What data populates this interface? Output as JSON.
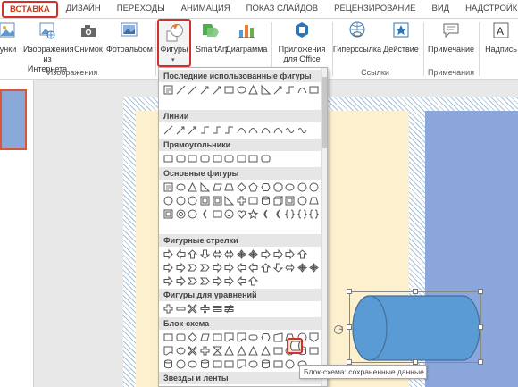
{
  "tabs": [
    {
      "label": "ВСТАВКА",
      "active": true
    },
    {
      "label": "ДИЗАЙН"
    },
    {
      "label": "ПЕРЕХОДЫ"
    },
    {
      "label": "АНИМАЦИЯ"
    },
    {
      "label": "ПОКАЗ СЛАЙДОВ"
    },
    {
      "label": "РЕЦЕНЗИРОВАНИЕ"
    },
    {
      "label": "ВИД"
    },
    {
      "label": "НАДСТРОЙКИ"
    }
  ],
  "ribbon": {
    "pictures": "унки",
    "online_images_l1": "Изображения",
    "online_images_l2": "из Интернета",
    "screenshot": "Снимок",
    "photo_album": "Фотоальбом",
    "shapes": "Фигуры",
    "smartart": "SmartArt",
    "chart": "Диаграмма",
    "apps_l1": "Приложения",
    "apps_l2": "для Office",
    "hyperlink": "Гиперссылка",
    "action": "Действие",
    "comment": "Примечание",
    "textbox": "Надпись",
    "group_images": "Изображения",
    "group_links": "Ссылки",
    "group_comments": "Примечания"
  },
  "shapes_menu": {
    "sections": [
      "Последние использованные фигуры",
      "Линии",
      "Прямоугольники",
      "Основные фигуры",
      "Фигурные стрелки",
      "Фигуры для уравнений",
      "Блок-схема",
      "Звезды и ленты"
    ]
  },
  "tooltip": "Блок-схема: сохраненные данные",
  "colors": {
    "accent_red": "#d42f2f",
    "slide_blue": "#8ba6da",
    "cylinder_blue": "#5b9bd5"
  }
}
